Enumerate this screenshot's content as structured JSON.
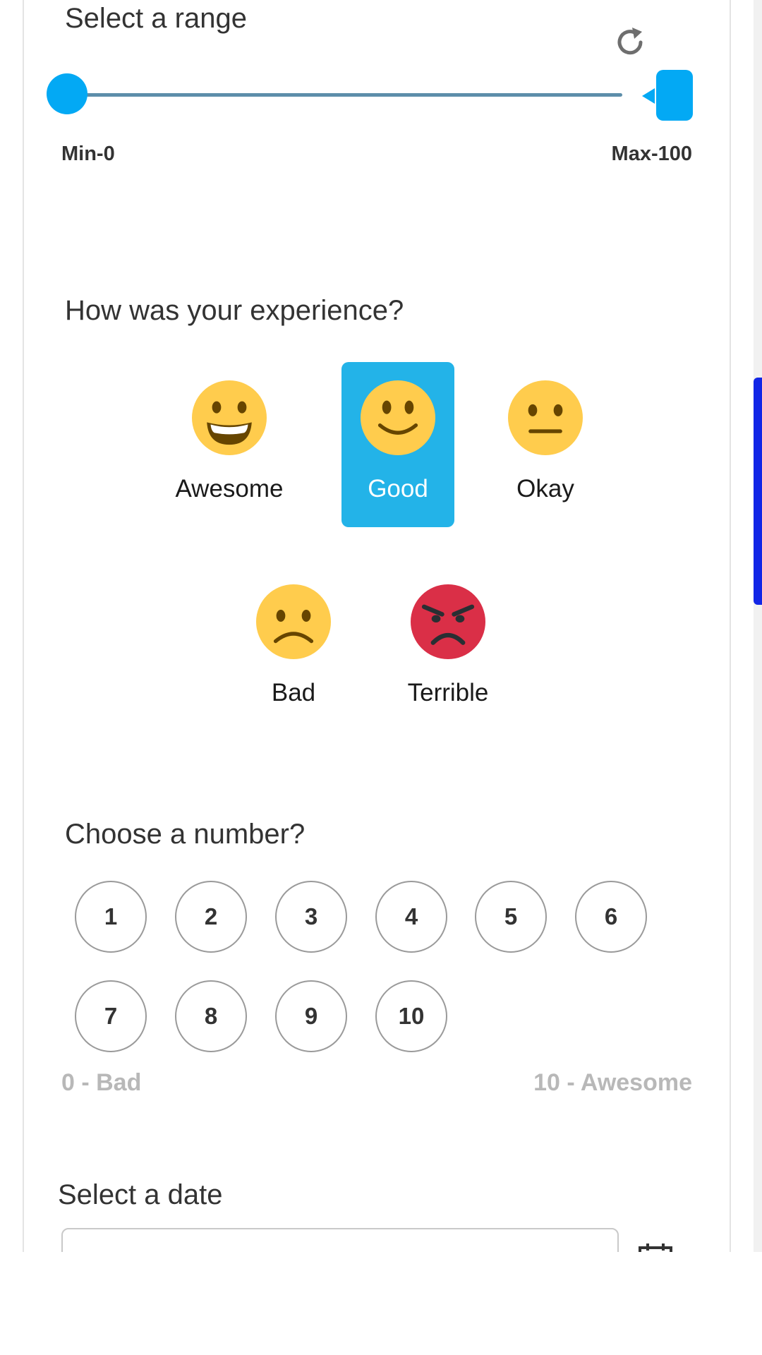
{
  "range": {
    "title": "Select a range",
    "min_label": "Min-0",
    "max_label": "Max-100",
    "value_min": 0,
    "value_max": 100
  },
  "experience": {
    "title": "How was your experience?",
    "options": [
      {
        "label": "Awesome",
        "icon": "grinning-face-icon"
      },
      {
        "label": "Good",
        "icon": "slightly-smiling-face-icon"
      },
      {
        "label": "Okay",
        "icon": "neutral-face-icon"
      },
      {
        "label": "Bad",
        "icon": "frowning-face-icon"
      },
      {
        "label": "Terrible",
        "icon": "angry-face-icon"
      }
    ],
    "selected": "Good",
    "colors": {
      "face": "#FFCC4D",
      "angry_face": "#DA2F47",
      "features": "#664500",
      "selected_bg": "#23B3E8"
    }
  },
  "number": {
    "title": "Choose a number?",
    "options": [
      "1",
      "2",
      "3",
      "4",
      "5",
      "6",
      "7",
      "8",
      "9",
      "10"
    ],
    "low_label": "0 - Bad",
    "high_label": "10 - Awesome"
  },
  "date": {
    "title": "Select a date",
    "value": ""
  },
  "colors": {
    "accent": "#03A9F4",
    "slider_track": "#5D8EAA",
    "scrollbar_thumb": "#1226E6"
  }
}
